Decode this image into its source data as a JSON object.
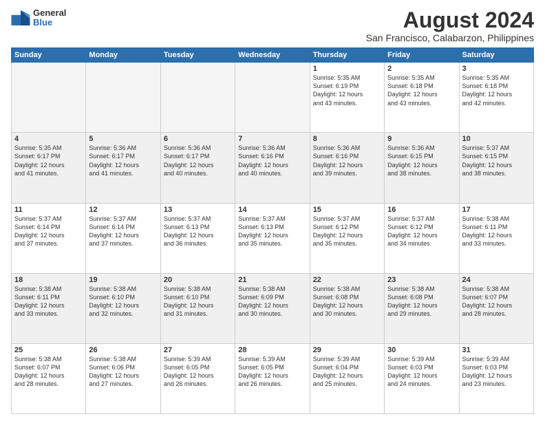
{
  "logo": {
    "general": "General",
    "blue": "Blue"
  },
  "header": {
    "month": "August 2024",
    "location": "San Francisco, Calabarzon, Philippines"
  },
  "weekdays": [
    "Sunday",
    "Monday",
    "Tuesday",
    "Wednesday",
    "Thursday",
    "Friday",
    "Saturday"
  ],
  "weeks": [
    [
      {
        "day": "",
        "info": "",
        "empty": true
      },
      {
        "day": "",
        "info": "",
        "empty": true
      },
      {
        "day": "",
        "info": "",
        "empty": true
      },
      {
        "day": "",
        "info": "",
        "empty": true
      },
      {
        "day": "1",
        "info": "Sunrise: 5:35 AM\nSunset: 6:19 PM\nDaylight: 12 hours\nand 43 minutes."
      },
      {
        "day": "2",
        "info": "Sunrise: 5:35 AM\nSunset: 6:18 PM\nDaylight: 12 hours\nand 43 minutes."
      },
      {
        "day": "3",
        "info": "Sunrise: 5:35 AM\nSunset: 6:18 PM\nDaylight: 12 hours\nand 42 minutes."
      }
    ],
    [
      {
        "day": "4",
        "info": "Sunrise: 5:35 AM\nSunset: 6:17 PM\nDaylight: 12 hours\nand 41 minutes.",
        "shaded": true
      },
      {
        "day": "5",
        "info": "Sunrise: 5:36 AM\nSunset: 6:17 PM\nDaylight: 12 hours\nand 41 minutes.",
        "shaded": true
      },
      {
        "day": "6",
        "info": "Sunrise: 5:36 AM\nSunset: 6:17 PM\nDaylight: 12 hours\nand 40 minutes.",
        "shaded": true
      },
      {
        "day": "7",
        "info": "Sunrise: 5:36 AM\nSunset: 6:16 PM\nDaylight: 12 hours\nand 40 minutes.",
        "shaded": true
      },
      {
        "day": "8",
        "info": "Sunrise: 5:36 AM\nSunset: 6:16 PM\nDaylight: 12 hours\nand 39 minutes.",
        "shaded": true
      },
      {
        "day": "9",
        "info": "Sunrise: 5:36 AM\nSunset: 6:15 PM\nDaylight: 12 hours\nand 38 minutes.",
        "shaded": true
      },
      {
        "day": "10",
        "info": "Sunrise: 5:37 AM\nSunset: 6:15 PM\nDaylight: 12 hours\nand 38 minutes.",
        "shaded": true
      }
    ],
    [
      {
        "day": "11",
        "info": "Sunrise: 5:37 AM\nSunset: 6:14 PM\nDaylight: 12 hours\nand 37 minutes."
      },
      {
        "day": "12",
        "info": "Sunrise: 5:37 AM\nSunset: 6:14 PM\nDaylight: 12 hours\nand 37 minutes."
      },
      {
        "day": "13",
        "info": "Sunrise: 5:37 AM\nSunset: 6:13 PM\nDaylight: 12 hours\nand 36 minutes."
      },
      {
        "day": "14",
        "info": "Sunrise: 5:37 AM\nSunset: 6:13 PM\nDaylight: 12 hours\nand 35 minutes."
      },
      {
        "day": "15",
        "info": "Sunrise: 5:37 AM\nSunset: 6:12 PM\nDaylight: 12 hours\nand 35 minutes."
      },
      {
        "day": "16",
        "info": "Sunrise: 5:37 AM\nSunset: 6:12 PM\nDaylight: 12 hours\nand 34 minutes."
      },
      {
        "day": "17",
        "info": "Sunrise: 5:38 AM\nSunset: 6:11 PM\nDaylight: 12 hours\nand 33 minutes."
      }
    ],
    [
      {
        "day": "18",
        "info": "Sunrise: 5:38 AM\nSunset: 6:11 PM\nDaylight: 12 hours\nand 33 minutes.",
        "shaded": true
      },
      {
        "day": "19",
        "info": "Sunrise: 5:38 AM\nSunset: 6:10 PM\nDaylight: 12 hours\nand 32 minutes.",
        "shaded": true
      },
      {
        "day": "20",
        "info": "Sunrise: 5:38 AM\nSunset: 6:10 PM\nDaylight: 12 hours\nand 31 minutes.",
        "shaded": true
      },
      {
        "day": "21",
        "info": "Sunrise: 5:38 AM\nSunset: 6:09 PM\nDaylight: 12 hours\nand 30 minutes.",
        "shaded": true
      },
      {
        "day": "22",
        "info": "Sunrise: 5:38 AM\nSunset: 6:08 PM\nDaylight: 12 hours\nand 30 minutes.",
        "shaded": true
      },
      {
        "day": "23",
        "info": "Sunrise: 5:38 AM\nSunset: 6:08 PM\nDaylight: 12 hours\nand 29 minutes.",
        "shaded": true
      },
      {
        "day": "24",
        "info": "Sunrise: 5:38 AM\nSunset: 6:07 PM\nDaylight: 12 hours\nand 28 minutes.",
        "shaded": true
      }
    ],
    [
      {
        "day": "25",
        "info": "Sunrise: 5:38 AM\nSunset: 6:07 PM\nDaylight: 12 hours\nand 28 minutes."
      },
      {
        "day": "26",
        "info": "Sunrise: 5:38 AM\nSunset: 6:06 PM\nDaylight: 12 hours\nand 27 minutes."
      },
      {
        "day": "27",
        "info": "Sunrise: 5:39 AM\nSunset: 6:05 PM\nDaylight: 12 hours\nand 26 minutes."
      },
      {
        "day": "28",
        "info": "Sunrise: 5:39 AM\nSunset: 6:05 PM\nDaylight: 12 hours\nand 26 minutes."
      },
      {
        "day": "29",
        "info": "Sunrise: 5:39 AM\nSunset: 6:04 PM\nDaylight: 12 hours\nand 25 minutes."
      },
      {
        "day": "30",
        "info": "Sunrise: 5:39 AM\nSunset: 6:03 PM\nDaylight: 12 hours\nand 24 minutes."
      },
      {
        "day": "31",
        "info": "Sunrise: 5:39 AM\nSunset: 6:03 PM\nDaylight: 12 hours\nand 23 minutes."
      }
    ]
  ]
}
